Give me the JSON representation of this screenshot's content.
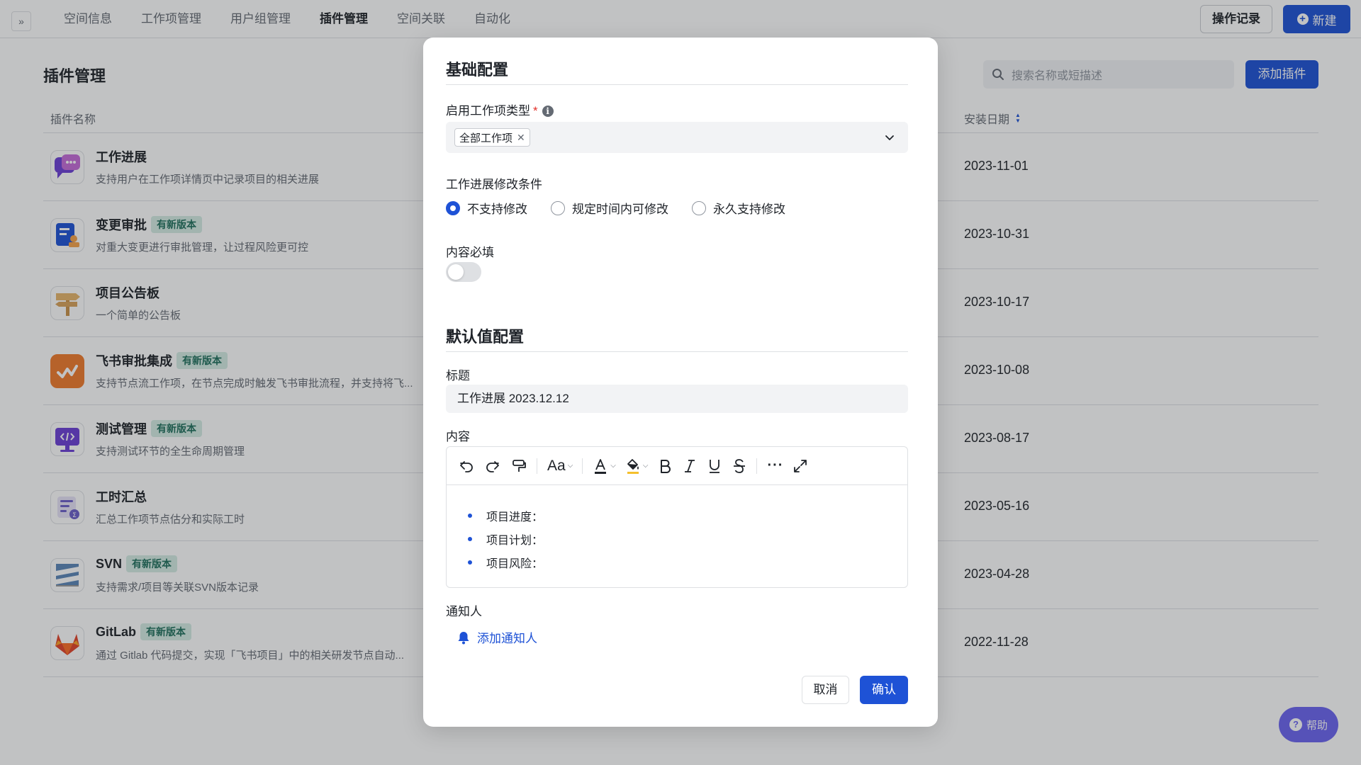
{
  "nav": {
    "tabs": [
      {
        "label": "空间信息"
      },
      {
        "label": "工作项管理"
      },
      {
        "label": "用户组管理"
      },
      {
        "label": "插件管理"
      },
      {
        "label": "空间关联"
      },
      {
        "label": "自动化"
      }
    ],
    "active_tab": "插件管理",
    "op_record_label": "操作记录",
    "new_label": "新建"
  },
  "page": {
    "title": "插件管理",
    "search_placeholder": "搜索名称或短描述",
    "add_plugin_label": "添加插件",
    "columns": {
      "name": "插件名称",
      "date": "安装日期"
    },
    "plugins": [
      {
        "name": "工作进展",
        "badge": "",
        "desc": "支持用户在工作项详情页中记录项目的相关进展",
        "date": "2023-11-01"
      },
      {
        "name": "变更审批",
        "badge": "有新版本",
        "desc": "对重大变更进行审批管理，让过程风险更可控",
        "date": "2023-10-31"
      },
      {
        "name": "项目公告板",
        "badge": "",
        "desc": "一个简单的公告板",
        "date": "2023-10-17"
      },
      {
        "name": "飞书审批集成",
        "badge": "有新版本",
        "desc": "支持节点流工作项，在节点完成时触发飞书审批流程，并支持将飞...",
        "date": "2023-10-08"
      },
      {
        "name": "测试管理",
        "badge": "有新版本",
        "desc": "支持测试环节的全生命周期管理",
        "date": "2023-08-17"
      },
      {
        "name": "工时汇总",
        "badge": "",
        "desc": "汇总工作项节点估分和实际工时",
        "date": "2023-05-16"
      },
      {
        "name": "SVN",
        "badge": "有新版本",
        "desc": "支持需求/项目等关联SVN版本记录",
        "date": "2023-04-28"
      },
      {
        "name": "GitLab",
        "badge": "有新版本",
        "desc": "通过 Gitlab 代码提交，实现「飞书项目」中的相关研发节点自动...",
        "date": "2022-11-28"
      }
    ],
    "help_label": "帮助"
  },
  "modal": {
    "basic_title": "基础配置",
    "type_label": "启用工作项类型",
    "required_mark": "*",
    "type_tag": "全部工作项",
    "modify_label": "工作进展修改条件",
    "radio_options": [
      {
        "label": "不支持修改",
        "checked": true
      },
      {
        "label": "规定时间内可修改",
        "checked": false
      },
      {
        "label": "永久支持修改",
        "checked": false
      }
    ],
    "content_required_label": "内容必填",
    "content_required_on": false,
    "default_title": "默认值配置",
    "title_label": "标题",
    "title_value": "工作进展 2023.12.12",
    "content_label": "内容",
    "editor_font_label": "Aa",
    "bullets": [
      "项目进度：",
      "项目计划：",
      "项目风险："
    ],
    "notify_label": "通知人",
    "add_notify_label": "添加通知人",
    "cancel_label": "取消",
    "confirm_label": "确认"
  },
  "colors": {
    "primary": "#1e52d6",
    "badge_bg": "#d4ece4",
    "help": "#6b64f0"
  }
}
